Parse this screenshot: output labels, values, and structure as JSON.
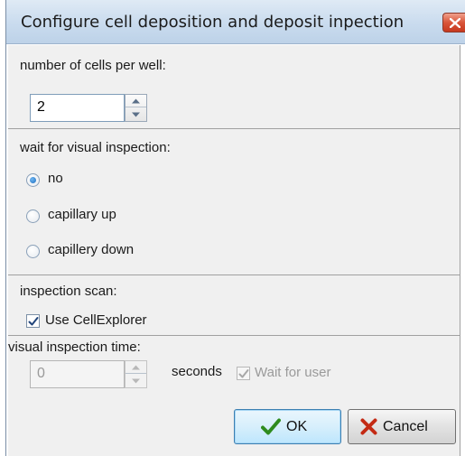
{
  "window": {
    "title": "Configure cell deposition and deposit inpection"
  },
  "cells": {
    "label": "number of cells per well:",
    "value": "2"
  },
  "wait": {
    "label": "wait for visual inspection:",
    "options": [
      {
        "label": "no",
        "selected": true
      },
      {
        "label": "capillary up",
        "selected": false
      },
      {
        "label": "capillery down",
        "selected": false
      }
    ]
  },
  "scan": {
    "label": "inspection scan:",
    "use_cellexplorer_label": "Use CellExplorer",
    "use_cellexplorer_checked": true
  },
  "inspection_time": {
    "label": "visual inspection time:",
    "value": "0",
    "unit": "seconds",
    "wait_for_user_label": "Wait for user",
    "wait_for_user_checked": true,
    "enabled": false
  },
  "buttons": {
    "ok": "OK",
    "cancel": "Cancel"
  },
  "colors": {
    "ok_check": "#2e8b1e",
    "cancel_x": "#c42a14",
    "radio_dot": "#1f6fbf"
  }
}
